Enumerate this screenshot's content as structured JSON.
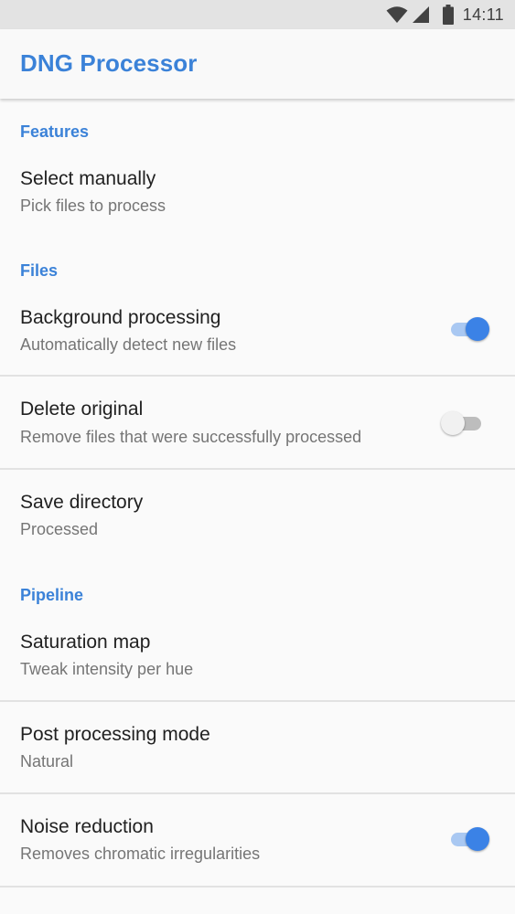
{
  "status_bar": {
    "time": "14:11",
    "icons": [
      "wifi-icon",
      "signal-icon",
      "battery-icon"
    ]
  },
  "app_bar": {
    "title": "DNG Processor"
  },
  "colors": {
    "accent": "#3b82d8",
    "switch_on": "#3b82e6",
    "switch_on_track": "#a9c8f2",
    "switch_off_track": "#bdbdbd"
  },
  "sections": [
    {
      "label": "Features",
      "items": [
        {
          "title": "Select manually",
          "summary": "Pick files to process"
        }
      ]
    },
    {
      "label": "Files",
      "items": [
        {
          "title": "Background processing",
          "summary": "Automatically detect new files",
          "switch": true
        },
        {
          "title": "Delete original",
          "summary": "Remove files that were successfully processed",
          "switch": false
        },
        {
          "title": "Save directory",
          "summary": "Processed"
        }
      ]
    },
    {
      "label": "Pipeline",
      "items": [
        {
          "title": "Saturation map",
          "summary": "Tweak intensity per hue"
        },
        {
          "title": "Post processing mode",
          "summary": "Natural"
        },
        {
          "title": "Noise reduction",
          "summary": "Removes chromatic irregularities",
          "switch": true
        }
      ]
    }
  ]
}
